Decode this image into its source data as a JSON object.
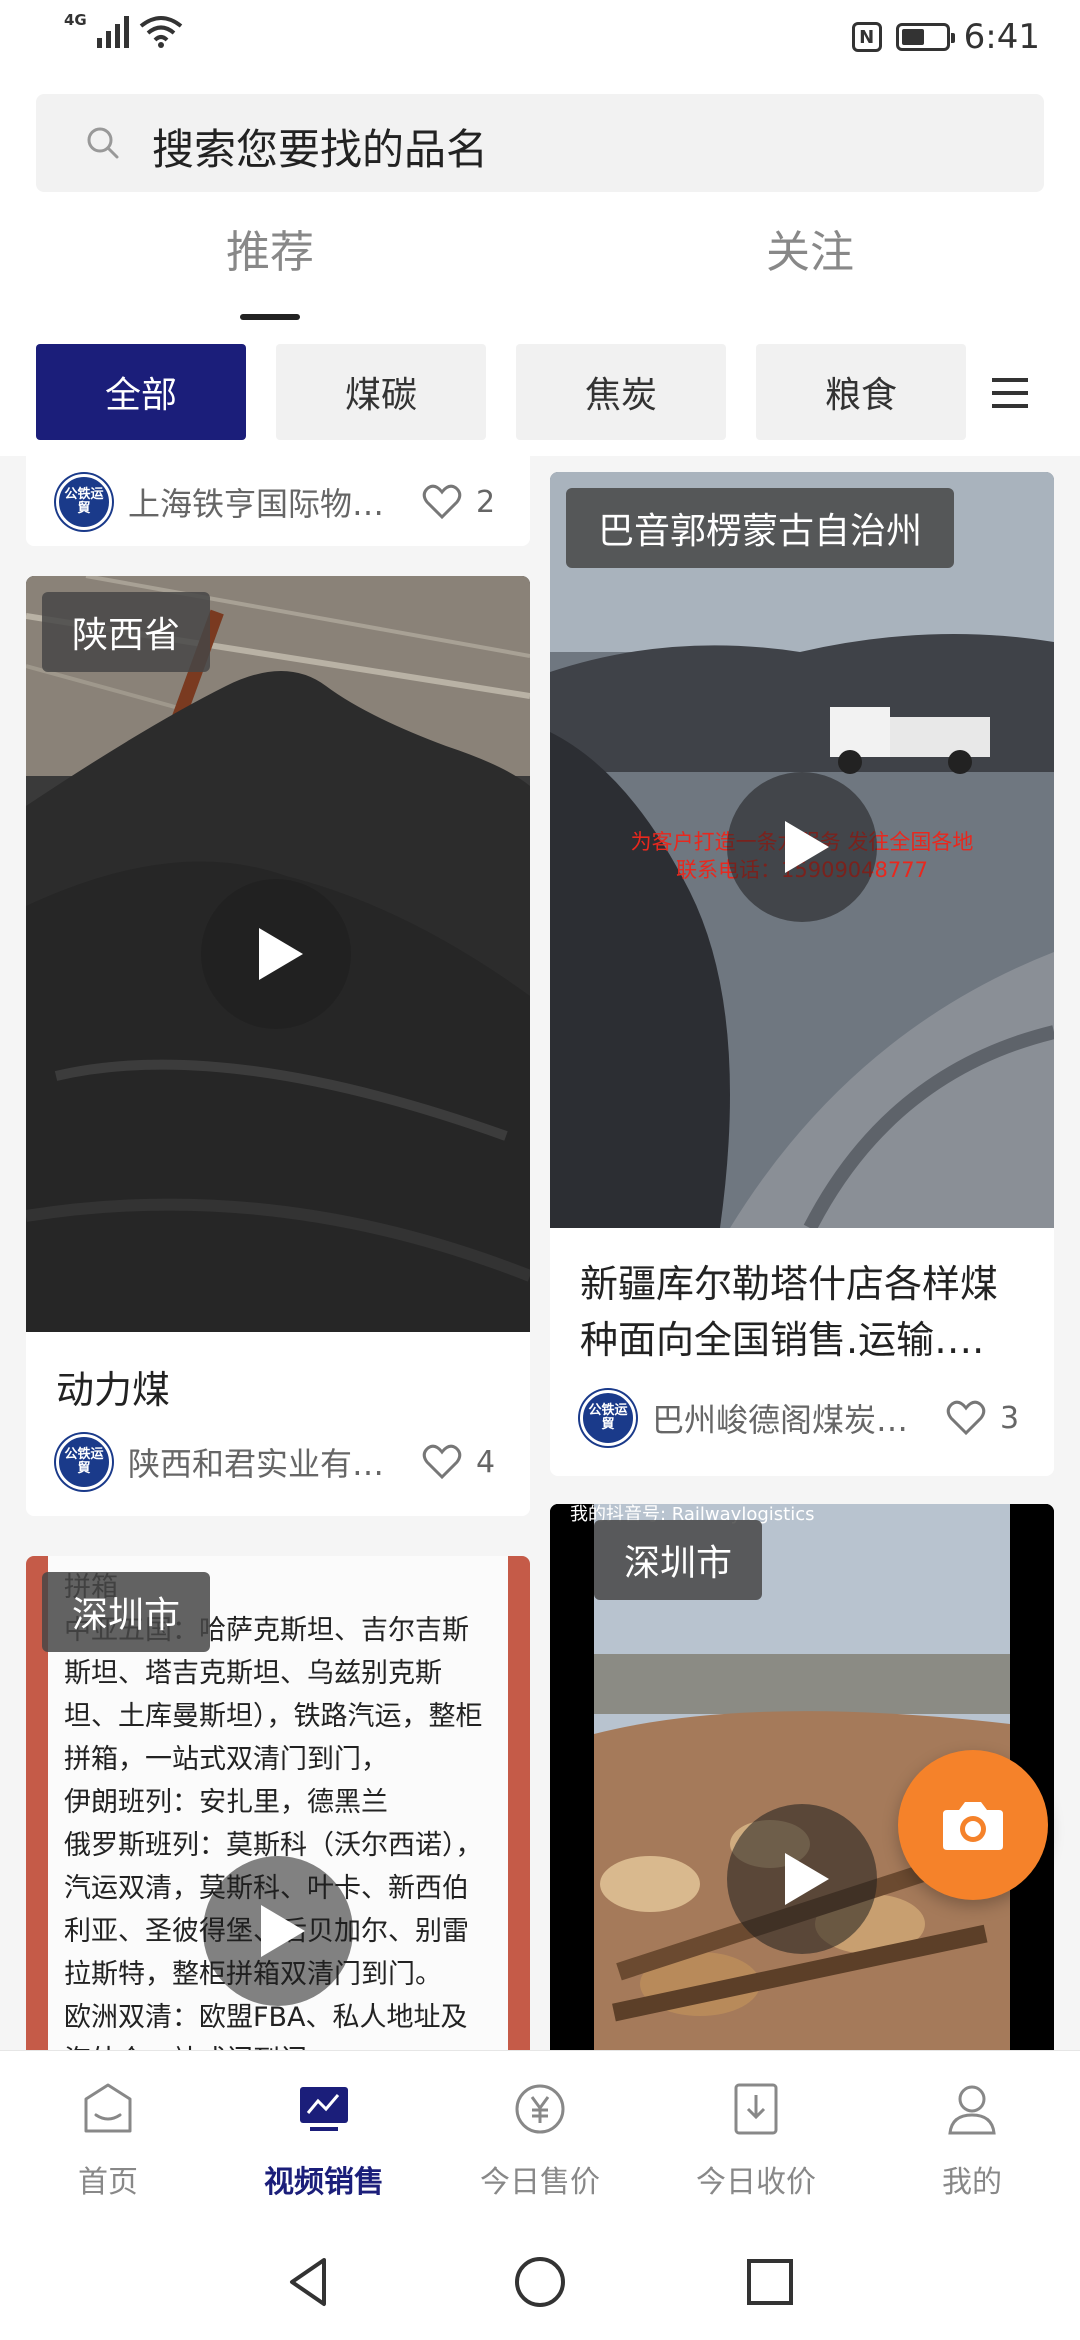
{
  "status_bar": {
    "network": "4G",
    "time": "6:41",
    "nfc": "N",
    "battery_level": 0.5
  },
  "search": {
    "placeholder": "搜索您要找的品名"
  },
  "tabs": [
    {
      "label": "推荐",
      "active": true
    },
    {
      "label": "关注",
      "active": false
    }
  ],
  "categories": [
    {
      "label": "全部",
      "active": true
    },
    {
      "label": "煤碳",
      "active": false
    },
    {
      "label": "焦炭",
      "active": false
    },
    {
      "label": "粮食",
      "active": false
    }
  ],
  "logo_text": "公铁运貿",
  "feed": {
    "card_partial": {
      "company": "上海铁亨国际物…",
      "likes": "2"
    },
    "card_shaanxi": {
      "location": "陕西省",
      "title": "动力煤",
      "company": "陕西和君实业有…",
      "likes": "4"
    },
    "card_bayin": {
      "location": "巴音郭楞蒙古自治州",
      "overlay_line1": "为客户打造一条龙服务 发往全国各地",
      "overlay_line2": "联系电话：15909048777",
      "title": "新疆库尔勒塔什店各样煤种面向全国销售.运输….",
      "company": "巴州峻德阁煤炭…",
      "likes": "3"
    },
    "card_shenzhen_text": {
      "location": "深圳市",
      "body": "拼箱\n中亚五国：哈萨克斯坦、吉尔吉斯斯坦、塔吉克斯坦、乌兹别克斯坦、土库曼斯坦），铁路汽运，整柜 拼箱，一站式双清门到门，\n伊朗班列：安扎里，德黑兰\n俄罗斯班列：莫斯科（沃尔西诺），汽运双清，莫斯科、叶卡、新西伯利亚、圣彼得堡、后贝加尔、别雷拉斯特，整柜拼箱双清门到门。\n欧洲双清：欧盟FBA、私人地址及海外仓一站式门到门\n欧洲美国 空派、海派、铁运 一站式双清门到门，承接FBA，私人地址，敏感货。！"
    },
    "card_shenzhen_logs": {
      "location": "深圳市",
      "watermark": "我的抖音号: Railwaylogistics"
    }
  },
  "bottom_nav": [
    {
      "label": "首页",
      "icon": "home-icon",
      "active": false
    },
    {
      "label": "视频销售",
      "icon": "video-sales-icon",
      "active": true
    },
    {
      "label": "今日售价",
      "icon": "yuan-price-icon",
      "active": false
    },
    {
      "label": "今日收价",
      "icon": "download-price-icon",
      "active": false
    },
    {
      "label": "我的",
      "icon": "profile-icon",
      "active": false
    }
  ],
  "colors": {
    "accent": "#1b1e7a",
    "fab": "#f5822a"
  }
}
